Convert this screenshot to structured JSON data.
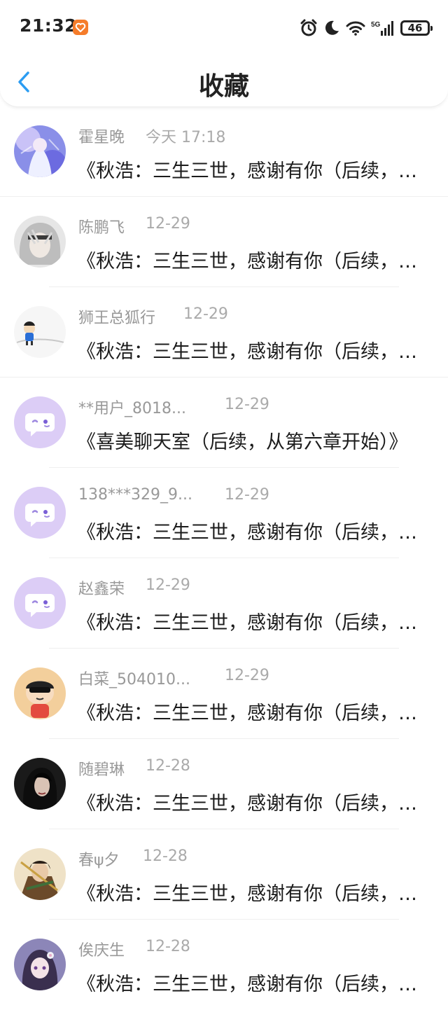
{
  "status_bar": {
    "time": "21:32",
    "battery": "46",
    "icons": [
      "app-heart-icon",
      "alarm-icon",
      "moon-icon",
      "wifi-icon",
      "5g-signal-icon",
      "battery-icon"
    ]
  },
  "header": {
    "title": "收藏",
    "back_icon": "chevron-left-icon"
  },
  "colors": {
    "accent": "#2b9cf2",
    "default_avatar": "#dccdf6",
    "name_gray": "#999999"
  },
  "items": [
    {
      "name": "霍星晚",
      "date": "今天 17:18",
      "message": "《秋浩：三生三世，感谢有你（后续，从第六章开始）》",
      "avatar": "anime-girl-avatar"
    },
    {
      "name": "陈鹏飞",
      "date": "12-29",
      "message": "《秋浩：三生三世，感谢有你（后续，从第六章开始）》",
      "avatar": "silver-hair-avatar"
    },
    {
      "name": "狮王总狐行",
      "date": "12-29",
      "message": "《秋浩：三生三世，感谢有你（后续，从第六章开始）》",
      "avatar": "cartoon-kid-avatar"
    },
    {
      "name": "**用户_8018...",
      "date": "12-29",
      "message": "《喜美聊天室（后续，从第六章开始）》",
      "avatar": "default-chat-avatar"
    },
    {
      "name": "138***329_9...",
      "date": "12-29",
      "message": "《秋浩：三生三世，感谢有你（后续，从第六章开始）》",
      "avatar": "default-chat-avatar"
    },
    {
      "name": "赵鑫荣",
      "date": "12-29",
      "message": "《秋浩：三生三世，感谢有你（后续，从第六章开始）》",
      "avatar": "default-chat-avatar"
    },
    {
      "name": "白菜_504010...",
      "date": "12-29",
      "message": "《秋浩：三生三世，感谢有你（后续，从第六章开始）》",
      "avatar": "crayon-boy-avatar"
    },
    {
      "name": "随碧琳",
      "date": "12-28",
      "message": "《秋浩：三生三世，感谢有你（后续，从第六章开始）》",
      "avatar": "dark-hair-girl-avatar"
    },
    {
      "name": "春ψ夕",
      "date": "12-28",
      "message": "《秋浩：三生三世，感谢有你（后续，从第六章开始）》",
      "avatar": "warrior-avatar"
    },
    {
      "name": "俟庆生",
      "date": "12-28",
      "message": "《秋浩：三生三世，感谢有你（后续，从第六章开始）》",
      "avatar": "anime-flower-girl-avatar"
    }
  ]
}
